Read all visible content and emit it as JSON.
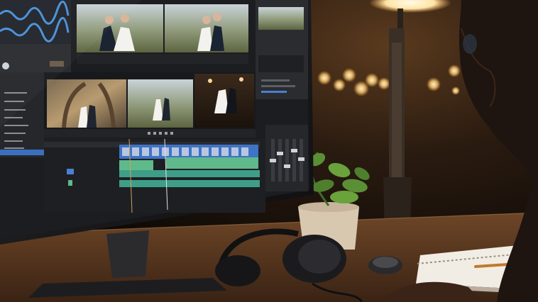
{
  "scene": {
    "description_tokens": [],
    "editor": {
      "bins": [
        "",
        "",
        "",
        "",
        "",
        "",
        "",
        "",
        ""
      ],
      "palette": {
        "panel": "#2b2c30",
        "panel_dark": "#1c1d20",
        "accent_blue": "#4a7fd1",
        "clip_green": "#5fb98a",
        "clip_teal": "#3f9e88",
        "lamp_glow": "#ffd49a",
        "wood": "#8a5a34"
      }
    }
  }
}
